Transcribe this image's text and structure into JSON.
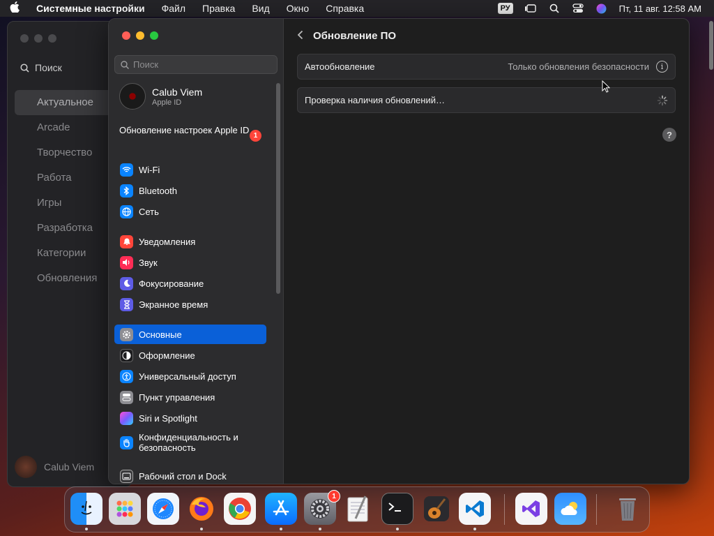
{
  "menubar": {
    "app_name": "Системные настройки",
    "menus": [
      "Файл",
      "Правка",
      "Вид",
      "Окно",
      "Справка"
    ],
    "lang": "РУ",
    "clock": "Пт, 11 авг.  12:58 AM"
  },
  "bg_window": {
    "search_label": "Поиск",
    "nav": [
      "Актуальное",
      "Arcade",
      "Творчество",
      "Работа",
      "Игры",
      "Разработка",
      "Категории",
      "Обновления"
    ],
    "user": "Calub Viem"
  },
  "sidebar": {
    "search_placeholder": "Поиск",
    "account": {
      "name": "Calub Viem",
      "sub": "Apple ID"
    },
    "appleid_update": "Обновление настроек Apple ID",
    "appleid_badge": "1",
    "items": [
      {
        "label": "Wi-Fi",
        "icon": "wifi-icon",
        "color": "#0a84ff"
      },
      {
        "label": "Bluetooth",
        "icon": "bluetooth-icon",
        "color": "#0a84ff"
      },
      {
        "label": "Сеть",
        "icon": "globe-icon",
        "color": "#0a84ff"
      },
      {
        "label": "Уведомления",
        "icon": "bell-icon",
        "color": "#ff453a"
      },
      {
        "label": "Звук",
        "icon": "speaker-icon",
        "color": "#ff2d55"
      },
      {
        "label": "Фокусирование",
        "icon": "moon-icon",
        "color": "#5e5ce6"
      },
      {
        "label": "Экранное время",
        "icon": "hourglass-icon",
        "color": "#5e5ce6"
      },
      {
        "label": "Основные",
        "icon": "gear-icon",
        "color": "#8e8e93"
      },
      {
        "label": "Оформление",
        "icon": "appearance-icon",
        "color": "#1c1c1e"
      },
      {
        "label": "Универсальный доступ",
        "icon": "accessibility-icon",
        "color": "#0a84ff"
      },
      {
        "label": "Пункт управления",
        "icon": "control-center-icon",
        "color": "#8e8e93"
      },
      {
        "label": "Siri и Spotlight",
        "icon": "siri-icon",
        "color": "#7d3cff"
      },
      {
        "label": "Конфиденциальность и безопасность",
        "icon": "hand-icon",
        "color": "#0a84ff"
      },
      {
        "label": "Рабочий стол и Dock",
        "icon": "dock-icon",
        "color": "#3a3a3c"
      }
    ]
  },
  "content": {
    "title": "Обновление ПО",
    "auto_label": "Автообновление",
    "auto_value": "Только обновления безопасности",
    "check_label": "Проверка наличия обновлений…",
    "help": "?"
  },
  "dock": {
    "settings_badge": "1",
    "apps": [
      "Finder",
      "Launchpad",
      "Safari",
      "Firefox",
      "Chrome",
      "App Store",
      "Системные настройки",
      "TextEdit",
      "Терминал",
      "GarageBand",
      "Visual Studio Code",
      "Visual Studio",
      "Погода",
      "Корзина"
    ]
  },
  "colors": {
    "accent": "#0a60d8",
    "badge": "#ff453a"
  }
}
